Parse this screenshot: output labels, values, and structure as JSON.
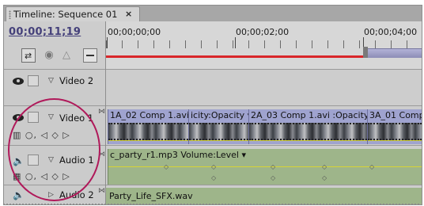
{
  "window": {
    "tab_title": "Timeline: Sequence 01",
    "tab_close": "×"
  },
  "header": {
    "timecode": "00;00;11;19",
    "ruler_labels": [
      "00;00;00;00",
      "00;00;02;00",
      "00;00;04;00"
    ],
    "tools": {
      "snap_glyph": "⇄",
      "marker_glyph": "◉",
      "keyframe_glyph": "△"
    }
  },
  "tracks": {
    "video2": {
      "name": "Video 2",
      "twirl": "▽"
    },
    "video1": {
      "name": "Video 1",
      "twirl": "▽",
      "controls_icons": "▥ ○, ◁ ◇ ▷",
      "clips": [
        {
          "title": "1A_02 Comp 1.avi"
        },
        {
          "title": "icity:Opacity ▾"
        },
        {
          "title": "2A_03 Comp 1.avi :Opacity ▾"
        },
        {
          "title": "3A_01 Comp"
        }
      ]
    },
    "audio1": {
      "name": "Audio 1",
      "twirl": "▽",
      "controls_icons": "▦ ○, ◁ ◇ ▷",
      "clip": {
        "title": "c_party_r1.mp3 Volume:Level ▾"
      }
    },
    "audio2": {
      "name": "Audio 2",
      "twirl": "▷",
      "clip": {
        "title": "Party_Life_SFX.wav"
      }
    }
  },
  "colors": {
    "accent_timecode": "#44407a",
    "render_bar": "#d9262a",
    "video_clip": "#9fa3cf",
    "audio_clip": "#9eb58a",
    "highlight_oval": "#b0195a"
  }
}
